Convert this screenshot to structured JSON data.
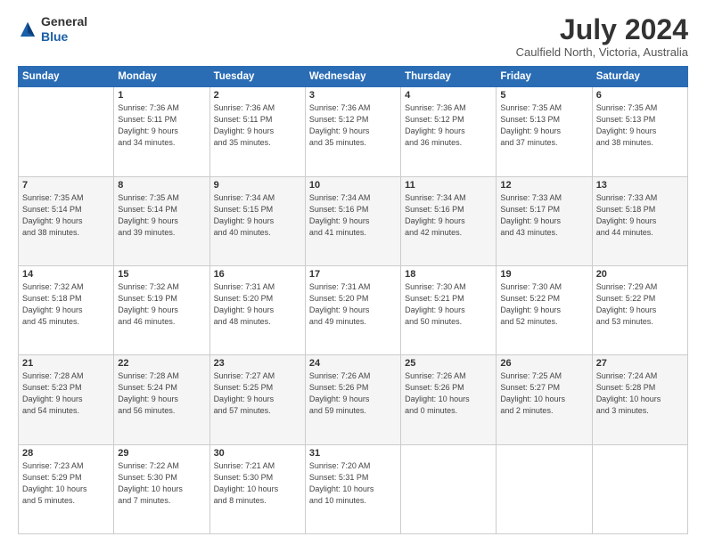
{
  "header": {
    "logo_line1": "General",
    "logo_line2": "Blue",
    "month_title": "July 2024",
    "location": "Caulfield North, Victoria, Australia"
  },
  "days_of_week": [
    "Sunday",
    "Monday",
    "Tuesday",
    "Wednesday",
    "Thursday",
    "Friday",
    "Saturday"
  ],
  "weeks": [
    [
      {
        "day": "",
        "info": ""
      },
      {
        "day": "1",
        "info": "Sunrise: 7:36 AM\nSunset: 5:11 PM\nDaylight: 9 hours\nand 34 minutes."
      },
      {
        "day": "2",
        "info": "Sunrise: 7:36 AM\nSunset: 5:11 PM\nDaylight: 9 hours\nand 35 minutes."
      },
      {
        "day": "3",
        "info": "Sunrise: 7:36 AM\nSunset: 5:12 PM\nDaylight: 9 hours\nand 35 minutes."
      },
      {
        "day": "4",
        "info": "Sunrise: 7:36 AM\nSunset: 5:12 PM\nDaylight: 9 hours\nand 36 minutes."
      },
      {
        "day": "5",
        "info": "Sunrise: 7:35 AM\nSunset: 5:13 PM\nDaylight: 9 hours\nand 37 minutes."
      },
      {
        "day": "6",
        "info": "Sunrise: 7:35 AM\nSunset: 5:13 PM\nDaylight: 9 hours\nand 38 minutes."
      }
    ],
    [
      {
        "day": "7",
        "info": "Sunrise: 7:35 AM\nSunset: 5:14 PM\nDaylight: 9 hours\nand 38 minutes."
      },
      {
        "day": "8",
        "info": "Sunrise: 7:35 AM\nSunset: 5:14 PM\nDaylight: 9 hours\nand 39 minutes."
      },
      {
        "day": "9",
        "info": "Sunrise: 7:34 AM\nSunset: 5:15 PM\nDaylight: 9 hours\nand 40 minutes."
      },
      {
        "day": "10",
        "info": "Sunrise: 7:34 AM\nSunset: 5:16 PM\nDaylight: 9 hours\nand 41 minutes."
      },
      {
        "day": "11",
        "info": "Sunrise: 7:34 AM\nSunset: 5:16 PM\nDaylight: 9 hours\nand 42 minutes."
      },
      {
        "day": "12",
        "info": "Sunrise: 7:33 AM\nSunset: 5:17 PM\nDaylight: 9 hours\nand 43 minutes."
      },
      {
        "day": "13",
        "info": "Sunrise: 7:33 AM\nSunset: 5:18 PM\nDaylight: 9 hours\nand 44 minutes."
      }
    ],
    [
      {
        "day": "14",
        "info": "Sunrise: 7:32 AM\nSunset: 5:18 PM\nDaylight: 9 hours\nand 45 minutes."
      },
      {
        "day": "15",
        "info": "Sunrise: 7:32 AM\nSunset: 5:19 PM\nDaylight: 9 hours\nand 46 minutes."
      },
      {
        "day": "16",
        "info": "Sunrise: 7:31 AM\nSunset: 5:20 PM\nDaylight: 9 hours\nand 48 minutes."
      },
      {
        "day": "17",
        "info": "Sunrise: 7:31 AM\nSunset: 5:20 PM\nDaylight: 9 hours\nand 49 minutes."
      },
      {
        "day": "18",
        "info": "Sunrise: 7:30 AM\nSunset: 5:21 PM\nDaylight: 9 hours\nand 50 minutes."
      },
      {
        "day": "19",
        "info": "Sunrise: 7:30 AM\nSunset: 5:22 PM\nDaylight: 9 hours\nand 52 minutes."
      },
      {
        "day": "20",
        "info": "Sunrise: 7:29 AM\nSunset: 5:22 PM\nDaylight: 9 hours\nand 53 minutes."
      }
    ],
    [
      {
        "day": "21",
        "info": "Sunrise: 7:28 AM\nSunset: 5:23 PM\nDaylight: 9 hours\nand 54 minutes."
      },
      {
        "day": "22",
        "info": "Sunrise: 7:28 AM\nSunset: 5:24 PM\nDaylight: 9 hours\nand 56 minutes."
      },
      {
        "day": "23",
        "info": "Sunrise: 7:27 AM\nSunset: 5:25 PM\nDaylight: 9 hours\nand 57 minutes."
      },
      {
        "day": "24",
        "info": "Sunrise: 7:26 AM\nSunset: 5:26 PM\nDaylight: 9 hours\nand 59 minutes."
      },
      {
        "day": "25",
        "info": "Sunrise: 7:26 AM\nSunset: 5:26 PM\nDaylight: 10 hours\nand 0 minutes."
      },
      {
        "day": "26",
        "info": "Sunrise: 7:25 AM\nSunset: 5:27 PM\nDaylight: 10 hours\nand 2 minutes."
      },
      {
        "day": "27",
        "info": "Sunrise: 7:24 AM\nSunset: 5:28 PM\nDaylight: 10 hours\nand 3 minutes."
      }
    ],
    [
      {
        "day": "28",
        "info": "Sunrise: 7:23 AM\nSunset: 5:29 PM\nDaylight: 10 hours\nand 5 minutes."
      },
      {
        "day": "29",
        "info": "Sunrise: 7:22 AM\nSunset: 5:30 PM\nDaylight: 10 hours\nand 7 minutes."
      },
      {
        "day": "30",
        "info": "Sunrise: 7:21 AM\nSunset: 5:30 PM\nDaylight: 10 hours\nand 8 minutes."
      },
      {
        "day": "31",
        "info": "Sunrise: 7:20 AM\nSunset: 5:31 PM\nDaylight: 10 hours\nand 10 minutes."
      },
      {
        "day": "",
        "info": ""
      },
      {
        "day": "",
        "info": ""
      },
      {
        "day": "",
        "info": ""
      }
    ]
  ]
}
